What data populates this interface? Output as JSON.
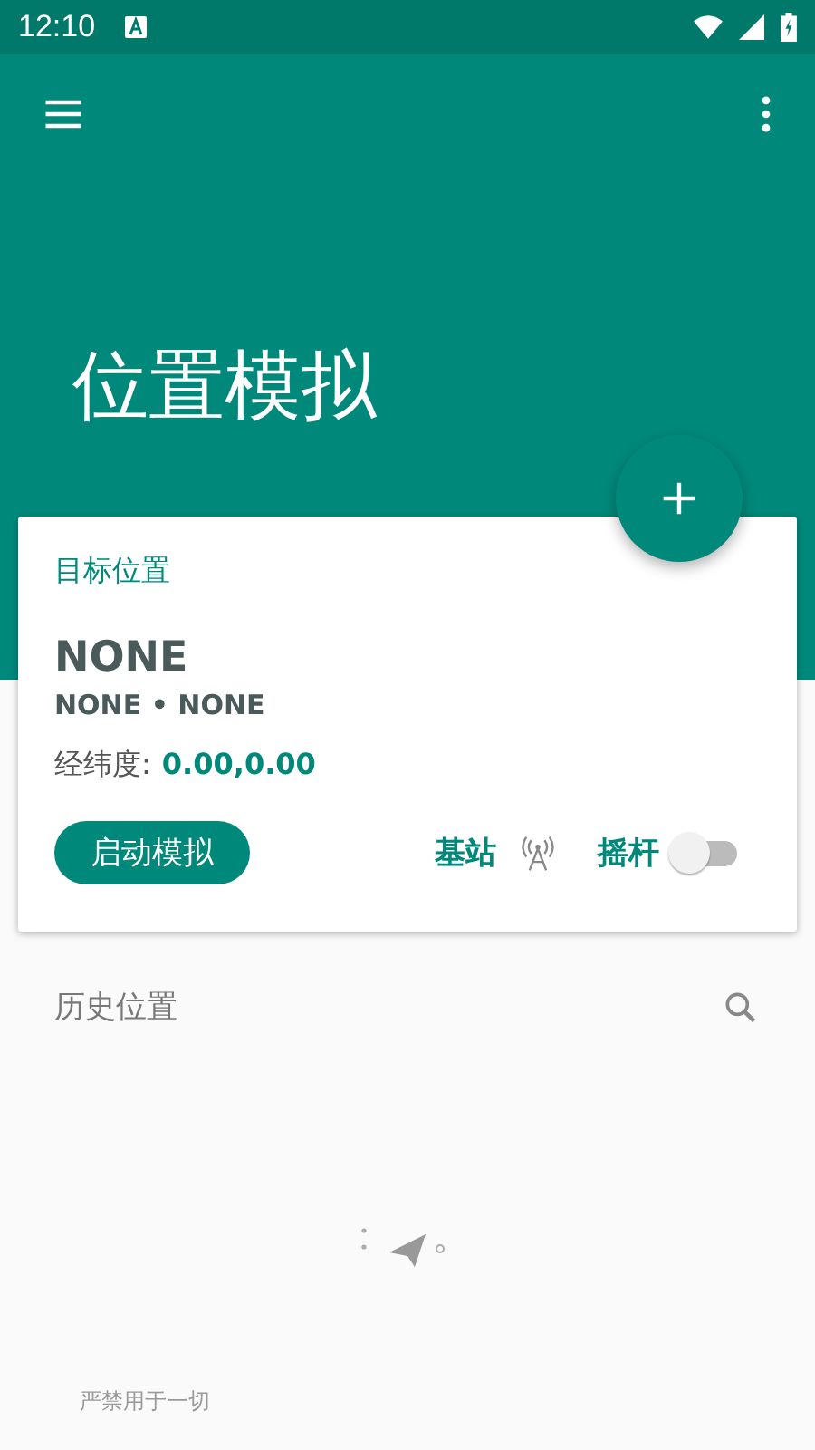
{
  "status_bar": {
    "time": "12:10"
  },
  "app_bar": {
    "title": "位置模拟"
  },
  "target_card": {
    "heading": "目标位置",
    "name": "NONE",
    "region": "NONE • NONE",
    "coords_label": "经纬度:",
    "coords_value": "0.00,0.00",
    "start_button": "启动模拟",
    "base_station_label": "基站",
    "joystick_label": "摇杆",
    "joystick": {
      "checked": false
    }
  },
  "history": {
    "title": "历史位置"
  },
  "footer": {
    "text": "严禁用于一切"
  }
}
